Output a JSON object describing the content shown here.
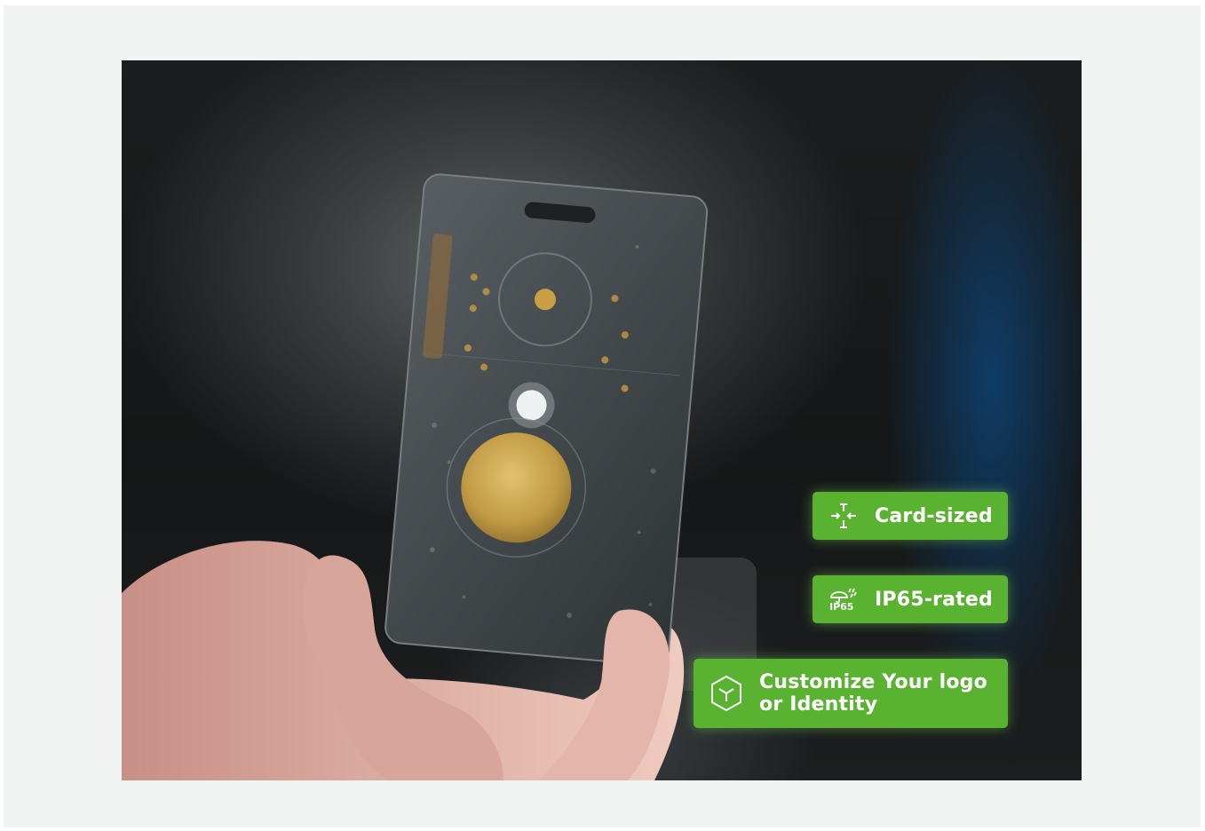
{
  "badges": {
    "card_sized": {
      "label": "Card-sized",
      "icon": "card-size-icon"
    },
    "ip65": {
      "label": "IP65-rated",
      "icon": "ip65-rain-icon",
      "icon_text": "IP65"
    },
    "customize": {
      "line1": "Customize Your logo",
      "line2": "or Identity",
      "icon": "cube-icon"
    }
  },
  "colors": {
    "badge_green": "#5ab231",
    "frame_bg": "#f0f3f2"
  }
}
